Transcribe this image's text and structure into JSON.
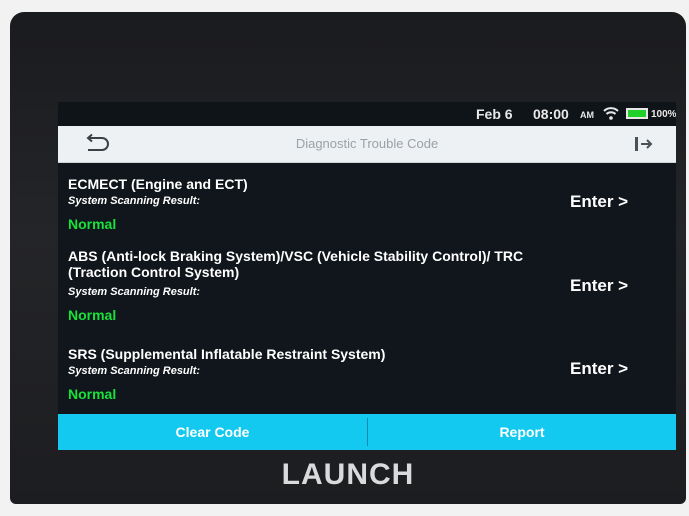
{
  "statusbar": {
    "date": "Feb 6",
    "time": "08:00",
    "signal": "AM",
    "battery": "100%"
  },
  "header": {
    "title": "Diagnostic Trouble Code"
  },
  "items": [
    {
      "title": "ECMECT (Engine and ECT)",
      "subtitle": "System Scanning Result:",
      "status": "Normal",
      "action": "Enter >"
    },
    {
      "title": "ABS (Anti-lock Braking System)/VSC (Vehicle Stability Control)/ TRC (Traction Control System)",
      "subtitle": "System Scanning Result:",
      "status": "Normal",
      "action": "Enter >"
    },
    {
      "title": "SRS (Supplemental Inflatable Restraint System)",
      "subtitle": "System Scanning Result:",
      "status": "Normal",
      "action": "Enter >"
    }
  ],
  "buttons": {
    "clear_code": "Clear Code",
    "report": "Report"
  },
  "device": {
    "brand": "LAUNCH"
  },
  "colors": {
    "accent": "#13c9f0",
    "status_ok": "#18e23a",
    "battery": "#1fd12a"
  }
}
